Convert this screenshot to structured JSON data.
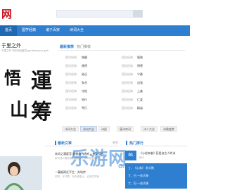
{
  "header": {
    "logo": "网",
    "logo_sub": "·········",
    "search_placeholder": ""
  },
  "nav": {
    "items": [
      {
        "label": "首页",
        "active": true
      },
      {
        "label": "国学经典"
      },
      {
        "label": "诸子百家"
      },
      {
        "label": "诗词大全"
      }
    ]
  },
  "hero": {
    "title": "于里之外",
    "desc": "千里之外  书法作品鉴赏  goo.lamaxy.cn gmk",
    "calligraphy": [
      "悟",
      "山",
      "運",
      "筹"
    ]
  },
  "recommend": {
    "tabs": [
      "最新推荐",
      "热门推荐"
    ],
    "rows": [
      {
        "k1": "国学经典",
        "v1": "独醒",
        "k2": "国学经典",
        "v2": "慎独"
      },
      {
        "k1": "国学经典",
        "v1": "厚德",
        "k2": "国学经典",
        "v2": "明德"
      },
      {
        "k1": "国学经典",
        "v1": "致远",
        "k2": "国学经典",
        "v2": "宁静"
      },
      {
        "k1": "国学经典",
        "v1": "和合",
        "k2": "国学经典",
        "v2": "自强"
      },
      {
        "k1": "国学经典",
        "v1": "守拙",
        "k2": "国学经典",
        "v2": "上善"
      },
      {
        "k1": "国学经典",
        "v1": "知行",
        "k2": "国学经典",
        "v2": "仁爱"
      },
      {
        "k1": "国学经典",
        "v1": "笃行",
        "k2": "国学经典",
        "v2": "精诚"
      }
    ]
  },
  "tags": {
    "left_mark": "",
    "items": [
      {
        "label": "诗词大全"
      },
      {
        "label": "诗句大全",
        "active": true
      },
      {
        "label": "诗经"
      },
      {
        "label": "唐诗宋词"
      },
      {
        "label": "诗人大全"
      },
      {
        "label": "诗歌鉴赏"
      }
    ]
  },
  "latest": {
    "title": "最新文章",
    "more": "更多",
    "items": [
      {
        "title": "宋词之满庭芳·碧雅梅残香府，夜深月色",
        "sub": "宋代诗人周邦彦的满庭芳，词中描写梅花"
      },
      {
        "title": "一蓑烟雨任平生：苏轼传",
        "sub": "苏轼，字子瞻，号东坡居士，北宋文学家"
      }
    ]
  },
  "hot": {
    "title": "热门排行",
    "rank_no": "01",
    "rank_title": "《心若奔者》·吾爱自古人的诗",
    "rank_sub": "诗人",
    "list": [
      "丁、《心若》 苏大陕",
      "丁、白 一苏大陕",
      "丁、归 一苏大陕"
    ]
  },
  "watermark": {
    "text": "乐游网",
    "en": "c.cn"
  }
}
